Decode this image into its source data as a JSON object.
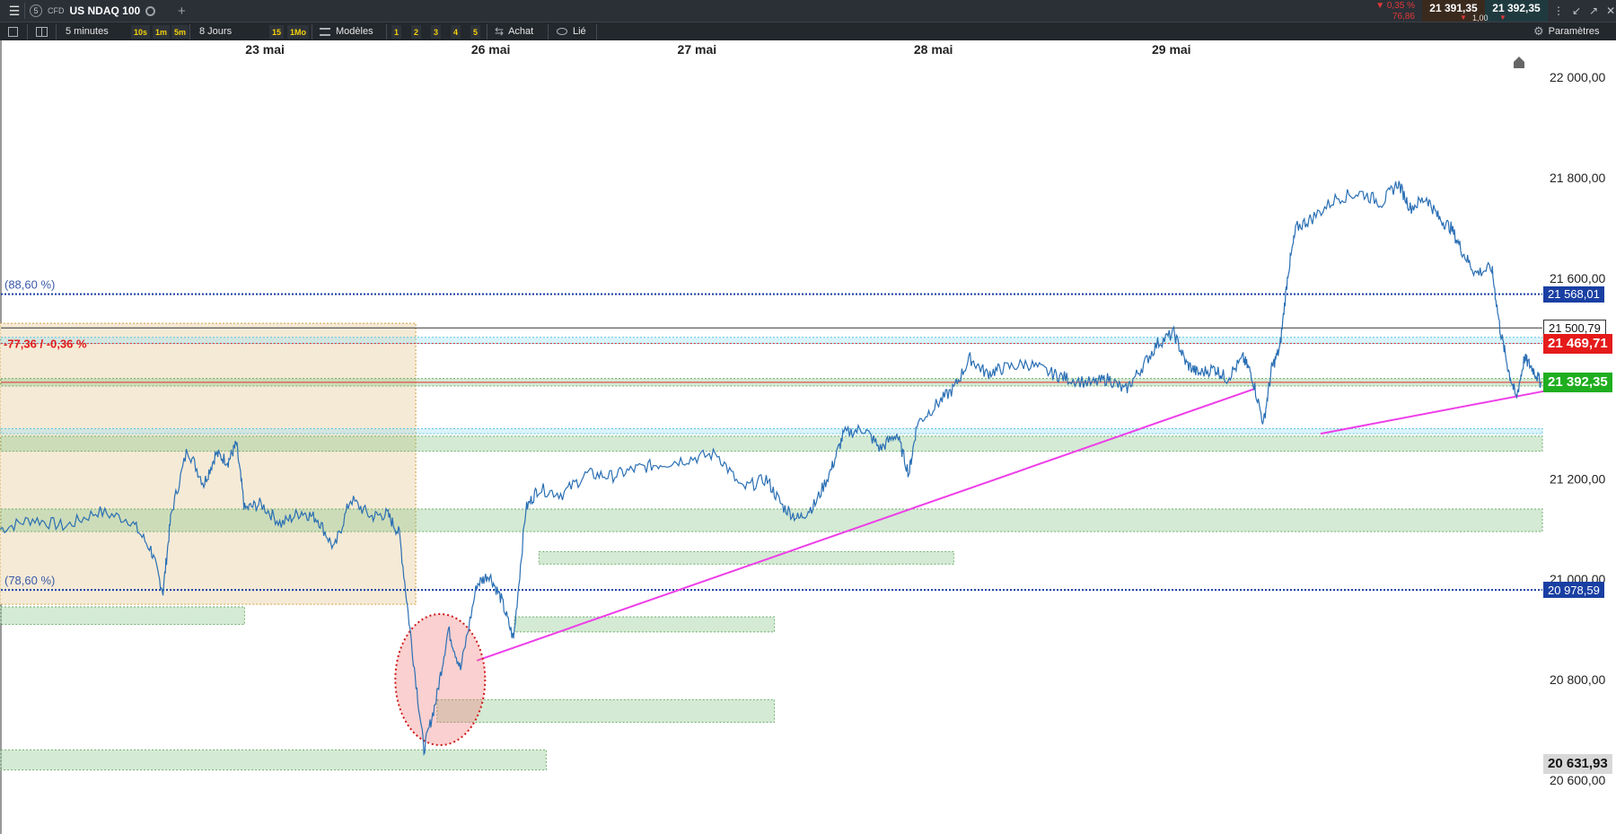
{
  "app": {
    "menu_icon": "hamburger-icon",
    "instrument_number": "5",
    "instrument_type": "CFD",
    "instrument_name": "US NDAQ 100",
    "search_icon": "search-icon",
    "add_tab_symbol": "+",
    "change_pct": "▼ 0,35 %",
    "change_pts": "76,86",
    "sell_price": "21 391,35",
    "buy_price": "21 392,35",
    "spread": "1,00",
    "accent_sell": "#3a2a1e",
    "accent_buy": "#1f3a3f"
  },
  "toolbar": {
    "interval": "5 minutes",
    "quick_intervals": [
      "10s",
      "1m",
      "5m"
    ],
    "range": "8 Jours",
    "quick_ranges": [
      "15",
      "1Mo"
    ],
    "templates_label": "Modèles",
    "numbers": [
      "1",
      "2",
      "3",
      "4",
      "5"
    ],
    "buy_label": "Achat",
    "linked_label": "Lié",
    "settings_label": "Paramètres"
  },
  "chart_data": {
    "type": "line",
    "instrument": "US NDAQ 100",
    "interval": "5 minutes",
    "x_tick_labels": [
      "23 mai",
      "26 mai",
      "27 mai",
      "28 mai",
      "29 mai"
    ],
    "y_tick_labels": [
      "22 000,00",
      "21 800,00",
      "21 600,00",
      "21 200,00",
      "21 000,00",
      "20 800,00",
      "20 600,00"
    ],
    "ylim": [
      20560,
      22030
    ],
    "series": [
      {
        "color": "#2a6fb4",
        "points": [
          [
            0,
            21100
          ],
          [
            0.4,
            21120
          ],
          [
            0.8,
            21105
          ],
          [
            1.2,
            21135
          ],
          [
            1.6,
            21118
          ],
          [
            1.85,
            21060
          ],
          [
            2.0,
            20975
          ],
          [
            2.1,
            21130
          ],
          [
            2.3,
            21260
          ],
          [
            2.5,
            21190
          ],
          [
            2.65,
            21250
          ],
          [
            2.8,
            21235
          ],
          [
            2.9,
            21270
          ],
          [
            3.0,
            21140
          ],
          [
            3.2,
            21150
          ],
          [
            3.45,
            21110
          ],
          [
            3.7,
            21135
          ],
          [
            3.9,
            21120
          ],
          [
            4.1,
            21060
          ],
          [
            4.3,
            21160
          ],
          [
            4.55,
            21125
          ],
          [
            4.75,
            21130
          ],
          [
            4.9,
            21090
          ],
          [
            5.05,
            20870
          ],
          [
            5.2,
            20660
          ],
          [
            5.35,
            20760
          ],
          [
            5.5,
            20900
          ],
          [
            5.65,
            20820
          ],
          [
            5.85,
            20990
          ],
          [
            6.0,
            21010
          ],
          [
            6.15,
            20960
          ],
          [
            6.3,
            20880
          ],
          [
            6.45,
            21140
          ],
          [
            6.6,
            21180
          ],
          [
            6.9,
            21170
          ],
          [
            7.2,
            21210
          ],
          [
            7.5,
            21205
          ],
          [
            7.8,
            21220
          ],
          [
            8.1,
            21230
          ],
          [
            8.45,
            21240
          ],
          [
            8.8,
            21250
          ],
          [
            9.1,
            21180
          ],
          [
            9.4,
            21200
          ],
          [
            9.6,
            21145
          ],
          [
            9.8,
            21120
          ],
          [
            10.0,
            21150
          ],
          [
            10.2,
            21220
          ],
          [
            10.35,
            21290
          ],
          [
            10.6,
            21300
          ],
          [
            10.8,
            21260
          ],
          [
            11.0,
            21290
          ],
          [
            11.15,
            21210
          ],
          [
            11.25,
            21310
          ],
          [
            11.5,
            21350
          ],
          [
            11.7,
            21380
          ],
          [
            11.9,
            21440
          ],
          [
            12.1,
            21410
          ],
          [
            12.3,
            21420
          ],
          [
            12.6,
            21430
          ],
          [
            12.9,
            21410
          ],
          [
            13.1,
            21400
          ],
          [
            13.4,
            21390
          ],
          [
            13.6,
            21400
          ],
          [
            13.8,
            21375
          ],
          [
            14.0,
            21420
          ],
          [
            14.2,
            21470
          ],
          [
            14.4,
            21490
          ],
          [
            14.55,
            21430
          ],
          [
            14.7,
            21410
          ],
          [
            14.9,
            21420
          ],
          [
            15.05,
            21400
          ],
          [
            15.25,
            21440
          ],
          [
            15.35,
            21410
          ],
          [
            15.5,
            21310
          ],
          [
            15.6,
            21420
          ],
          [
            15.7,
            21460
          ],
          [
            15.8,
            21610
          ],
          [
            15.9,
            21700
          ],
          [
            16.1,
            21720
          ],
          [
            16.4,
            21760
          ],
          [
            16.7,
            21770
          ],
          [
            16.95,
            21750
          ],
          [
            17.15,
            21790
          ],
          [
            17.3,
            21740
          ],
          [
            17.5,
            21760
          ],
          [
            17.65,
            21720
          ],
          [
            17.8,
            21700
          ],
          [
            17.95,
            21650
          ],
          [
            18.1,
            21610
          ],
          [
            18.3,
            21620
          ],
          [
            18.4,
            21500
          ],
          [
            18.5,
            21420
          ],
          [
            18.6,
            21360
          ],
          [
            18.7,
            21440
          ],
          [
            18.8,
            21420
          ],
          [
            18.9,
            21392
          ]
        ]
      }
    ],
    "horizontal_lines": [
      {
        "label": "(88,60 %)",
        "price_tag": "21 568,01",
        "value": 21568.01
      },
      {
        "label": "(78,60 %)",
        "price_tag": "20 978,59",
        "value": 20978.59
      },
      {
        "price_tag": "21 500,79",
        "value": 21500.79
      },
      {
        "price_tag": "21 469,71",
        "value": 21469.71
      },
      {
        "price_tag": "21 392,35",
        "value": 21392.35
      },
      {
        "price_tag": "20 631,93",
        "value": 20631.93
      }
    ],
    "annotation": "-77,36 / -0,36 %",
    "support_zones": [
      {
        "x": [
          0,
          19.2
        ],
        "y": [
          21385,
          21400
        ]
      },
      {
        "x": [
          0,
          19.2
        ],
        "y": [
          21255,
          21285
        ]
      },
      {
        "x": [
          0,
          19.2
        ],
        "y": [
          21095,
          21140
        ]
      },
      {
        "x": [
          6.6,
          11.7
        ],
        "y": [
          21030,
          21055
        ]
      },
      {
        "x": [
          0,
          3.0
        ],
        "y": [
          20910,
          20945
        ]
      },
      {
        "x": [
          6.3,
          9.5
        ],
        "y": [
          20895,
          20925
        ]
      },
      {
        "x": [
          5.35,
          9.5
        ],
        "y": [
          20715,
          20760
        ]
      },
      {
        "x": [
          0,
          6.7
        ],
        "y": [
          20620,
          20660
        ]
      }
    ],
    "shaded_period": {
      "x": [
        0,
        5.1
      ],
      "y": [
        20950,
        21510
      ]
    },
    "trendlines": [
      {
        "from": [
          5.85,
          20838
        ],
        "to": [
          15.4,
          21380
        ]
      },
      {
        "from": [
          16.2,
          21290
        ],
        "to": [
          18.95,
          21375
        ]
      }
    ],
    "highlight_circle": {
      "x": 5.4,
      "y": 20800
    }
  }
}
